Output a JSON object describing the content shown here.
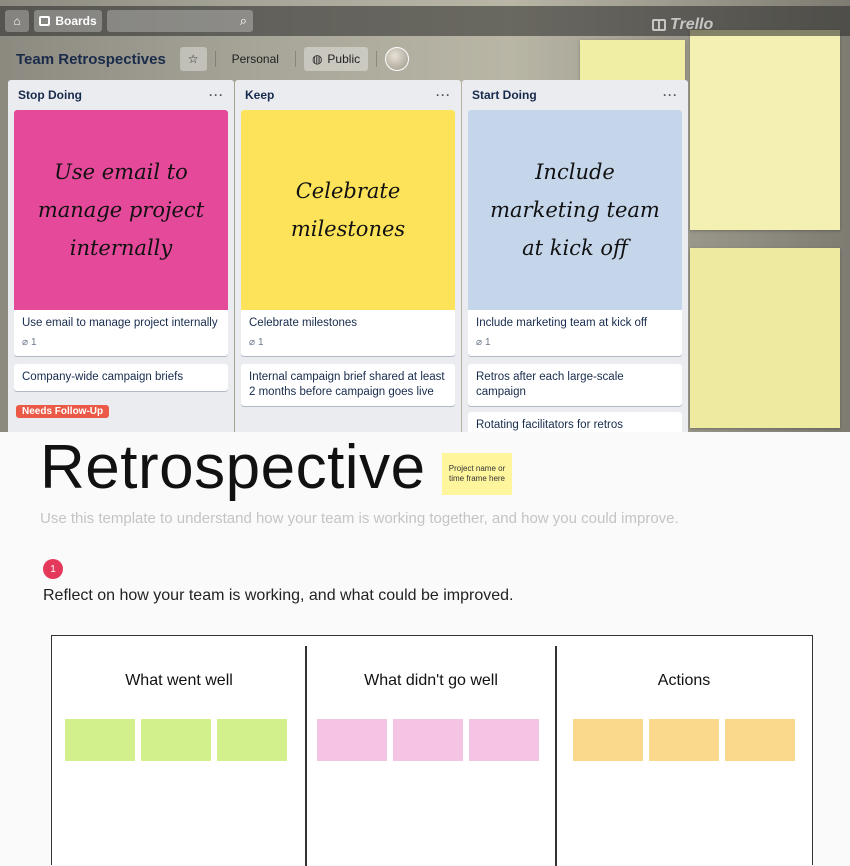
{
  "trello": {
    "nav": {
      "boards_label": "Boards",
      "brand": "Trello"
    },
    "board": {
      "title": "Team Retrospectives",
      "personal_label": "Personal",
      "public_label": "Public"
    },
    "lists": [
      {
        "title": "Stop Doing",
        "cover_text": "Use email to manage project internally",
        "cover_color": "#e4499a",
        "cards": [
          {
            "text": "Use email to manage project internally",
            "attachments": "1"
          },
          {
            "text": "Company-wide campaign briefs",
            "label": "Needs Follow-Up"
          }
        ]
      },
      {
        "title": "Keep",
        "cover_text": "Celebrate milestones",
        "cover_color": "#fce35a",
        "cards": [
          {
            "text": "Celebrate milestones",
            "attachments": "1"
          },
          {
            "text": "Internal campaign brief shared at least 2 months before campaign goes live"
          }
        ]
      },
      {
        "title": "Start Doing",
        "cover_text": "Include marketing team at kick off",
        "cover_color": "#c5d6ea",
        "cards": [
          {
            "text": "Include marketing team at kick off",
            "attachments": "1"
          },
          {
            "text": "Retros after each large-scale campaign"
          },
          {
            "text": "Rotating facilitators for retros"
          }
        ]
      }
    ]
  },
  "retro": {
    "title": "Retrospective",
    "tag": "Project name or time frame here",
    "subtitle": "Use this template to understand how your team is working together, and how you could improve.",
    "step_number": "1",
    "step_text": "Reflect on how your team is working, and what could be improved.",
    "columns": [
      {
        "title": "What went well",
        "sticky_color": "#d2f08c"
      },
      {
        "title": "What didn't go well",
        "sticky_color": "#f5c4e4"
      },
      {
        "title": "Actions",
        "sticky_color": "#fbd98c"
      }
    ]
  }
}
